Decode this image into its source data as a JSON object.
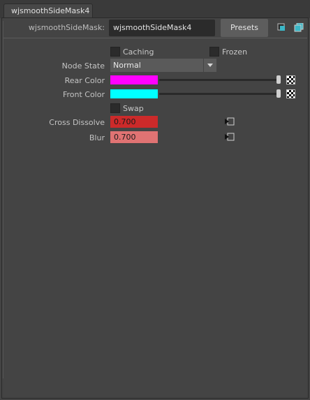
{
  "tab": {
    "label": "wjsmoothSideMask4"
  },
  "header": {
    "node_type_label": "wjsmoothSideMask:",
    "node_name": "wjsmoothSideMask4",
    "presets_label": "Presets"
  },
  "attributes": {
    "caching": {
      "label": "Caching",
      "checked": false
    },
    "frozen": {
      "label": "Frozen",
      "checked": false
    },
    "node_state": {
      "label": "Node State",
      "value": "Normal"
    },
    "rear_color": {
      "label": "Rear Color",
      "color": "#ff00ff",
      "slider": 1.0
    },
    "front_color": {
      "label": "Front Color",
      "color": "#00ffff",
      "slider": 1.0
    },
    "swap": {
      "label": "Swap",
      "checked": false
    },
    "cross_dissolve": {
      "label": "Cross Dissolve",
      "value": "0.700",
      "color": "#cc2a2a"
    },
    "blur": {
      "label": "Blur",
      "value": "0.700",
      "color": "#e07373"
    }
  },
  "icons": {
    "header_icon_1": "copy-tab-icon",
    "header_icon_2": "toggle-view-icon",
    "map_button": "map-connect-icon",
    "checker": "checker-map-icon"
  }
}
